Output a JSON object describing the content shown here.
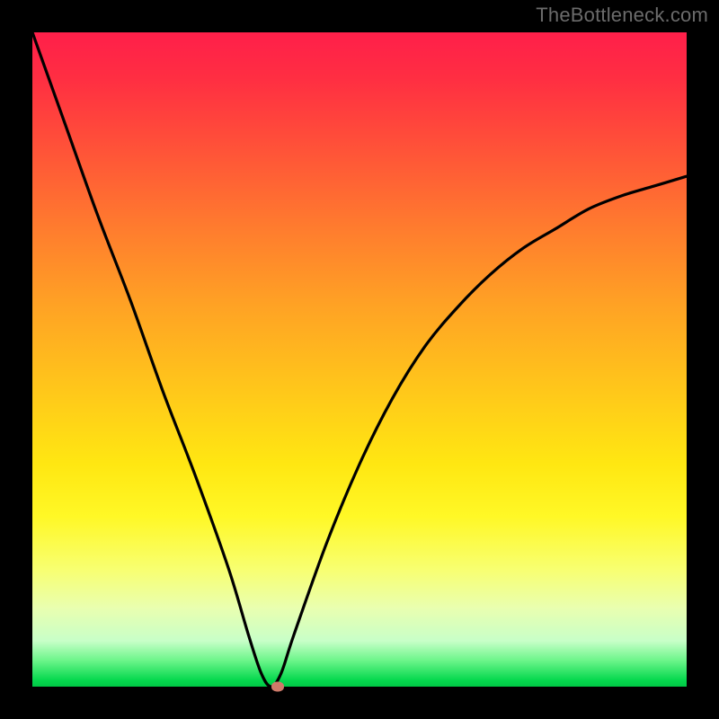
{
  "watermark": "TheBottleneck.com",
  "chart_data": {
    "type": "line",
    "title": "",
    "xlabel": "",
    "ylabel": "",
    "xlim": [
      0,
      100
    ],
    "ylim": [
      0,
      100
    ],
    "grid": false,
    "legend": false,
    "gradient_stops": [
      {
        "pos": 0,
        "color": "#ff1f4a"
      },
      {
        "pos": 50,
        "color": "#ffd21a"
      },
      {
        "pos": 80,
        "color": "#f7ff60"
      },
      {
        "pos": 100,
        "color": "#00c846"
      }
    ],
    "series": [
      {
        "name": "bottleneck-curve",
        "x": [
          0,
          5,
          10,
          15,
          20,
          25,
          30,
          33,
          35,
          36.5,
          38,
          40,
          45,
          50,
          55,
          60,
          65,
          70,
          75,
          80,
          85,
          90,
          95,
          100
        ],
        "y": [
          100,
          86,
          72,
          59,
          45,
          32,
          18,
          8,
          2,
          0,
          2,
          8,
          22,
          34,
          44,
          52,
          58,
          63,
          67,
          70,
          73,
          75,
          76.5,
          78
        ]
      }
    ],
    "marker": {
      "x": 37.5,
      "y": 0
    },
    "axes_visible": false
  }
}
